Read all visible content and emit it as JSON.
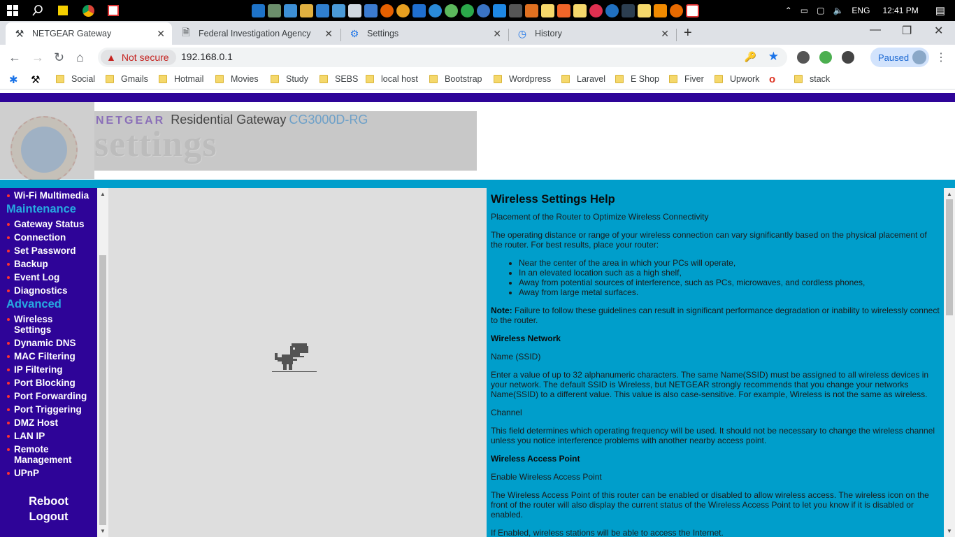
{
  "taskbar": {
    "language": "ENG",
    "time": "12:41 PM"
  },
  "tabs": [
    {
      "label": "NETGEAR Gateway",
      "icon": "tools-icon"
    },
    {
      "label": "Federal Investigation Agency",
      "icon": "page-icon"
    },
    {
      "label": "Settings",
      "icon": "gear-icon"
    },
    {
      "label": "History",
      "icon": "history-icon"
    }
  ],
  "addressbar": {
    "security": "Not secure",
    "url": "192.168.0.1",
    "profile_status": "Paused"
  },
  "bookmarks": [
    "Social",
    "Gmails",
    "Hotmail",
    "Movies",
    "Study",
    "SEBS",
    "local host",
    "Bootstrap",
    "Wordpress",
    "Laravel",
    "E Shop",
    "Fiver",
    "Upwork",
    "stack"
  ],
  "header": {
    "brand": "NETGEAR",
    "title": "Residential Gateway",
    "model": "CG3000D-RG",
    "banner": "settings",
    "seal_text": "SWITCHES | WIRELESS | ROUTERS | ADAPTERS | HUBS"
  },
  "sidebar": {
    "top_item": "Wi-Fi Multimedia",
    "maintenance_title": "Maintenance",
    "maintenance": [
      "Gateway Status",
      "Connection",
      "Set Password",
      "Backup",
      "Event Log",
      "Diagnostics"
    ],
    "advanced_title": "Advanced",
    "advanced": [
      "Wireless Settings",
      "Dynamic DNS",
      "MAC Filtering",
      "IP Filtering",
      "Port Blocking",
      "Port Forwarding",
      "Port Triggering",
      "DMZ Host",
      "LAN IP",
      "Remote Management",
      "UPnP"
    ],
    "reboot": "Reboot",
    "logout": "Logout"
  },
  "help": {
    "title": "Wireless Settings Help",
    "p1": "Placement of the Router to Optimize Wireless Connectivity",
    "p2": "The operating distance or range of your wireless connection can vary significantly based on the physical placement of the router. For best results, place your router:",
    "bullets": [
      "Near the center of the area in which your PCs will operate,",
      "In an elevated location such as a high shelf,",
      "Away from potential sources of interference, such as PCs, microwaves, and cordless phones,",
      "Away from large metal surfaces."
    ],
    "note_label": "Note:",
    "note_text": " Failure to follow these guidelines can result in significant performance degradation or inability to wirelessly connect to the router.",
    "h_network": "Wireless Network",
    "name_label": "Name (SSID)",
    "name_text": "Enter a value of up to 32 alphanumeric characters. The same Name(SSID) must be assigned to all wireless devices in your network. The default SSID is Wireless, but NETGEAR strongly recommends that you change your networks Name(SSID) to a different value. This value is also case-sensitive. For example, Wireless is not the same as wireless.",
    "channel_label": "Channel",
    "channel_text": "This field determines which operating frequency will be used. It should not be necessary to change the wireless channel unless you notice interference problems with another nearby access point.",
    "h_ap": "Wireless Access Point",
    "enable_label": "Enable Wireless Access Point",
    "enable_text": "The Wireless Access Point of this router can be enabled or disabled to allow wireless access. The wireless icon on the front of the router will also display the current status of the Wireless Access Point to let you know if it is disabled or enabled.",
    "enabled_text": "If Enabled, wireless stations will be able to access the Internet."
  },
  "colors": {
    "purple": "#2e0498",
    "cyan": "#009ecb",
    "section_blue": "#27a9e1"
  }
}
